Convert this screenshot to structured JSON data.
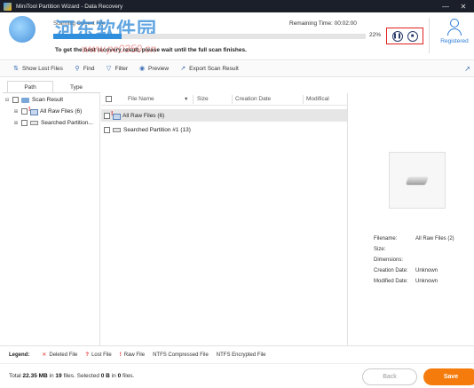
{
  "window": {
    "title": "MiniTool Partition Wizard - Data Recovery"
  },
  "watermark": {
    "text": "河东软件园",
    "url": "www.pc0359.cn"
  },
  "scan": {
    "label": "Scanning Current File",
    "remaining_time": "Remaining Time: 00:02:00",
    "progress_percent": "22%",
    "progress_fraction": 0.22,
    "hint": "To get the best recovery result, please wait until the full scan finishes.",
    "pause_icon": "pause-icon",
    "stop_icon": "stop-icon"
  },
  "account": {
    "label": "Registered"
  },
  "toolbar": {
    "show_lost_files": "Show Lost Files",
    "find": "Find",
    "filter": "Filter",
    "preview": "Preview",
    "export": "Export Scan Result"
  },
  "tabs": {
    "path": "Path",
    "type": "Type"
  },
  "tree": {
    "root": "Scan Result",
    "raw": "All Raw Files (6)",
    "partition": "Searched Partition..."
  },
  "columns": {
    "file_name": "File Name",
    "size": "Size",
    "creation_date": "Creation Date",
    "modified": "Modifical"
  },
  "rows": [
    {
      "name": "All Raw Files (6)"
    },
    {
      "name": "Searched Partition #1 (13)"
    }
  ],
  "details": {
    "filename_key": "Filename:",
    "filename_val": "All Raw Files (2)",
    "size_key": "Size:",
    "dimensions_key": "Dimensions:",
    "creation_key": "Creation Date:",
    "creation_val": "Unknown",
    "modified_key": "Modified Date:",
    "modified_val": "Unknown"
  },
  "legend": {
    "label": "Legend:",
    "deleted": "Deleted File",
    "lost": "Lost File",
    "raw": "Raw File",
    "ntfs_compressed": "NTFS Compressed File",
    "ntfs_encrypted": "NTFS Encrypted File"
  },
  "summary": {
    "total_prefix": "Total",
    "total_size": "22.35 MB",
    "in_word": "in",
    "total_files": "19",
    "files_selected": "files. Selected",
    "selected_size": "0 B",
    "selected_files": "0",
    "files_end": "files."
  },
  "buttons": {
    "back": "Back",
    "save": "Save"
  }
}
